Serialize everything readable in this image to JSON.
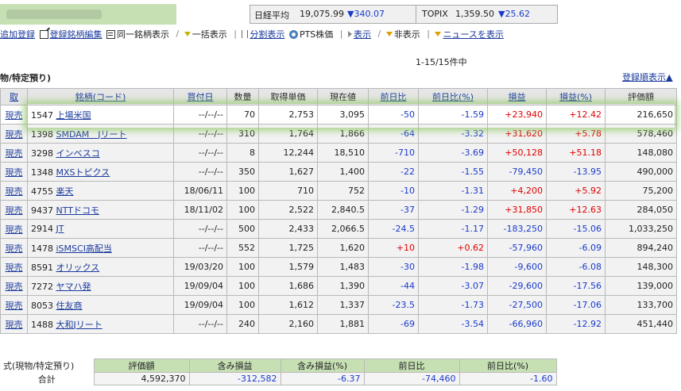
{
  "indices": {
    "nikkei_label": "日経平均",
    "nikkei_value": "19,075.99",
    "nikkei_change": "▼340.07",
    "topix_label": "TOPIX",
    "topix_value": "1,359.50",
    "topix_change": "▼25.62"
  },
  "toolbar": {
    "add_register": "追加登録",
    "edit_register": "登録銘柄編集",
    "same_stock": "同一銘柄表示",
    "bulk": "一括表示",
    "split": "分割表示",
    "pts": "PTS株価",
    "show": "表示",
    "hide": "非表示",
    "news": "ニュースを表示"
  },
  "count_text": "1-15/15件中",
  "section_title": "物/特定預り)",
  "sort_link": "登録順表示▲",
  "columns": [
    "取",
    "銘柄(コード)",
    "買付日",
    "数量",
    "取得単価",
    "現在値",
    "前日比",
    "前日比(%)",
    "損益",
    "損益(%)",
    "評価額"
  ],
  "rows": [
    {
      "action": "現売",
      "code": "1547",
      "name": "上場米国",
      "date": "--/--/--",
      "qty": "70",
      "cost": "2,753",
      "price": "3,095",
      "chg": "-50",
      "chg_pct": "-1.59",
      "pl": "+23,940",
      "pl_pct": "+12.42",
      "value": "216,650"
    },
    {
      "action": "現売",
      "code": "1398",
      "name": "SMDAM　Jリート",
      "date": "--/--/--",
      "qty": "310",
      "cost": "1,764",
      "price": "1,866",
      "chg": "-64",
      "chg_pct": "-3.32",
      "pl": "+31,620",
      "pl_pct": "+5.78",
      "value": "578,460"
    },
    {
      "action": "現売",
      "code": "3298",
      "name": "インベスコ",
      "date": "--/--/--",
      "qty": "8",
      "cost": "12,244",
      "price": "18,510",
      "chg": "-710",
      "chg_pct": "-3.69",
      "pl": "+50,128",
      "pl_pct": "+51.18",
      "value": "148,080"
    },
    {
      "action": "現売",
      "code": "1348",
      "name": "MXSトピクス",
      "date": "--/--/--",
      "qty": "350",
      "cost": "1,627",
      "price": "1,400",
      "chg": "-22",
      "chg_pct": "-1.55",
      "pl": "-79,450",
      "pl_pct": "-13.95",
      "value": "490,000"
    },
    {
      "action": "現売",
      "code": "4755",
      "name": "楽天",
      "date": "18/06/11",
      "qty": "100",
      "cost": "710",
      "price": "752",
      "chg": "-10",
      "chg_pct": "-1.31",
      "pl": "+4,200",
      "pl_pct": "+5.92",
      "value": "75,200"
    },
    {
      "action": "現売",
      "code": "9437",
      "name": "NTTドコモ",
      "date": "18/11/02",
      "qty": "100",
      "cost": "2,522",
      "price": "2,840.5",
      "chg": "-37",
      "chg_pct": "-1.29",
      "pl": "+31,850",
      "pl_pct": "+12.63",
      "value": "284,050"
    },
    {
      "action": "現売",
      "code": "2914",
      "name": "JT",
      "date": "--/--/--",
      "qty": "500",
      "cost": "2,433",
      "price": "2,066.5",
      "chg": "-24.5",
      "chg_pct": "-1.17",
      "pl": "-183,250",
      "pl_pct": "-15.06",
      "value": "1,033,250"
    },
    {
      "action": "現売",
      "code": "1478",
      "name": "iSMSCI高配当",
      "date": "--/--/--",
      "qty": "552",
      "cost": "1,725",
      "price": "1,620",
      "chg": "+10",
      "chg_pct": "+0.62",
      "pl": "-57,960",
      "pl_pct": "-6.09",
      "value": "894,240"
    },
    {
      "action": "現売",
      "code": "8591",
      "name": "オリックス",
      "date": "19/03/20",
      "qty": "100",
      "cost": "1,579",
      "price": "1,483",
      "chg": "-30",
      "chg_pct": "-1.98",
      "pl": "-9,600",
      "pl_pct": "-6.08",
      "value": "148,300"
    },
    {
      "action": "現売",
      "code": "7272",
      "name": "ヤマハ発",
      "date": "19/09/04",
      "qty": "100",
      "cost": "1,686",
      "price": "1,390",
      "chg": "-44",
      "chg_pct": "-3.07",
      "pl": "-29,600",
      "pl_pct": "-17.56",
      "value": "139,000"
    },
    {
      "action": "現売",
      "code": "8053",
      "name": "住友商",
      "date": "19/09/04",
      "qty": "100",
      "cost": "1,612",
      "price": "1,337",
      "chg": "-23.5",
      "chg_pct": "-1.73",
      "pl": "-27,500",
      "pl_pct": "-17.06",
      "value": "133,700"
    },
    {
      "action": "現売",
      "code": "1488",
      "name": "大和Jリート",
      "date": "--/--/--",
      "qty": "240",
      "cost": "2,160",
      "price": "1,881",
      "chg": "-69",
      "chg_pct": "-3.54",
      "pl": "-66,960",
      "pl_pct": "-12.92",
      "value": "451,440"
    }
  ],
  "summary": {
    "row_label_1": "式(現物/特定預り)",
    "row_label_2": "合計",
    "headers": [
      "評価額",
      "含み損益",
      "含み損益(%)",
      "前日比",
      "前日比(%)"
    ],
    "values": [
      "4,592,370",
      "-312,582",
      "-6.37",
      "-74,460",
      "-1.60"
    ]
  }
}
